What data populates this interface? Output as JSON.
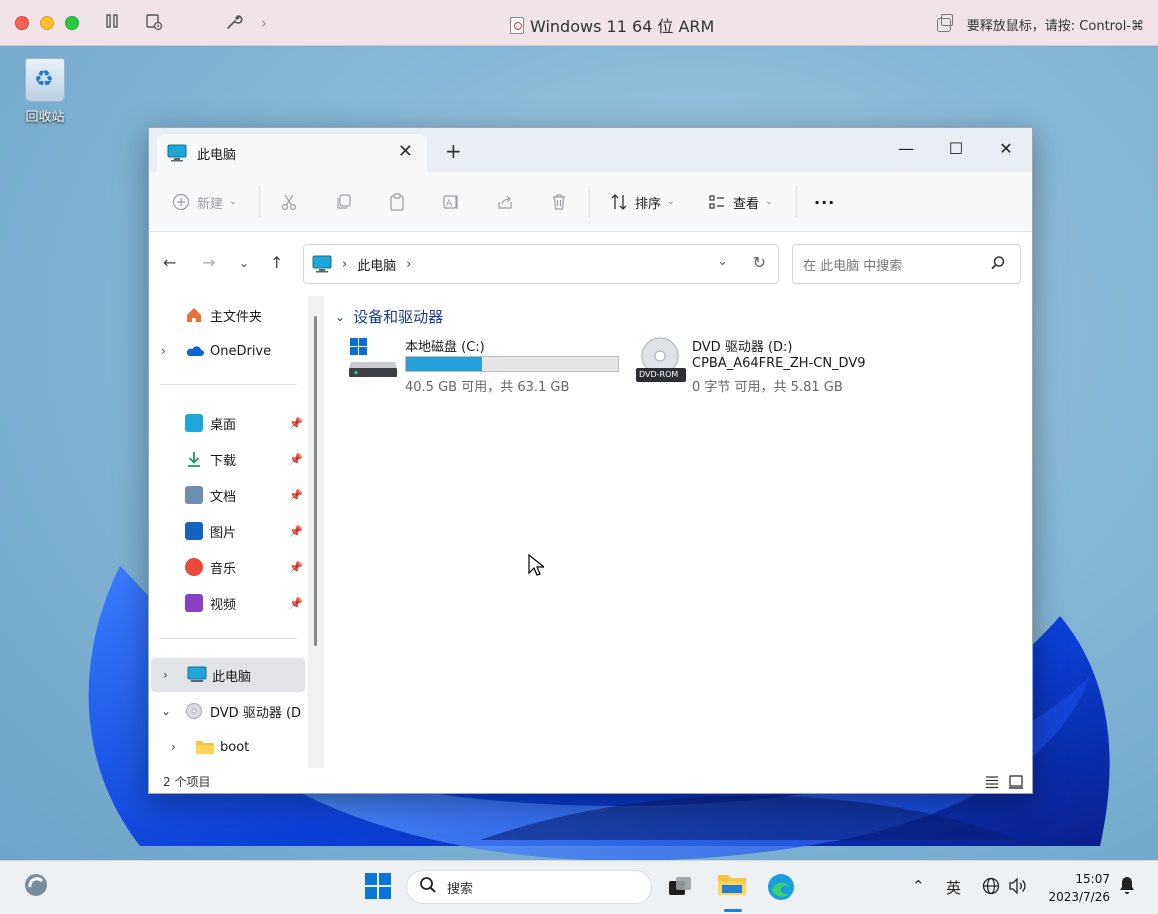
{
  "host": {
    "window_title": "Windows 11 64 位 ARM",
    "release_hint": "要释放鼠标，请按: Control-⌘"
  },
  "desktop": {
    "recycle_bin_label": "回收站"
  },
  "explorer": {
    "tab_title": "此电脑",
    "toolbar": {
      "new_label": "新建",
      "sort_label": "排序",
      "view_label": "查看",
      "more_label": "···"
    },
    "address": {
      "crumb": "此电脑",
      "separator": "›"
    },
    "search_placeholder": "在 此电脑 中搜索",
    "sidebar": {
      "quick": [
        {
          "label": "主文件夹"
        },
        {
          "label": "OneDrive"
        }
      ],
      "pinned": [
        {
          "label": "桌面"
        },
        {
          "label": "下载"
        },
        {
          "label": "文档"
        },
        {
          "label": "图片"
        },
        {
          "label": "音乐"
        },
        {
          "label": "视频"
        }
      ],
      "tree": [
        {
          "label": "此电脑"
        },
        {
          "label": "DVD 驱动器 (D"
        },
        {
          "label": "boot"
        }
      ]
    },
    "group_title": "设备和驱动器",
    "drives": [
      {
        "name": "本地磁盘 (C:)",
        "info": "40.5 GB 可用，共 63.1 GB",
        "used_fraction": 0.358
      },
      {
        "name": "DVD 驱动器 (D:)",
        "volume": "CPBA_A64FRE_ZH-CN_DV9",
        "info": "0 字节 可用，共 5.81 GB",
        "icon_text": "DVD-ROM"
      }
    ],
    "status": "2 个项目"
  },
  "taskbar": {
    "search_label": "搜索",
    "ime": "英",
    "time": "15:07",
    "date": "2023/7/26"
  },
  "colors": {
    "accent": "#26a0da",
    "group_title": "#1d3c8c",
    "selected_bg": "#e1e3e6"
  }
}
